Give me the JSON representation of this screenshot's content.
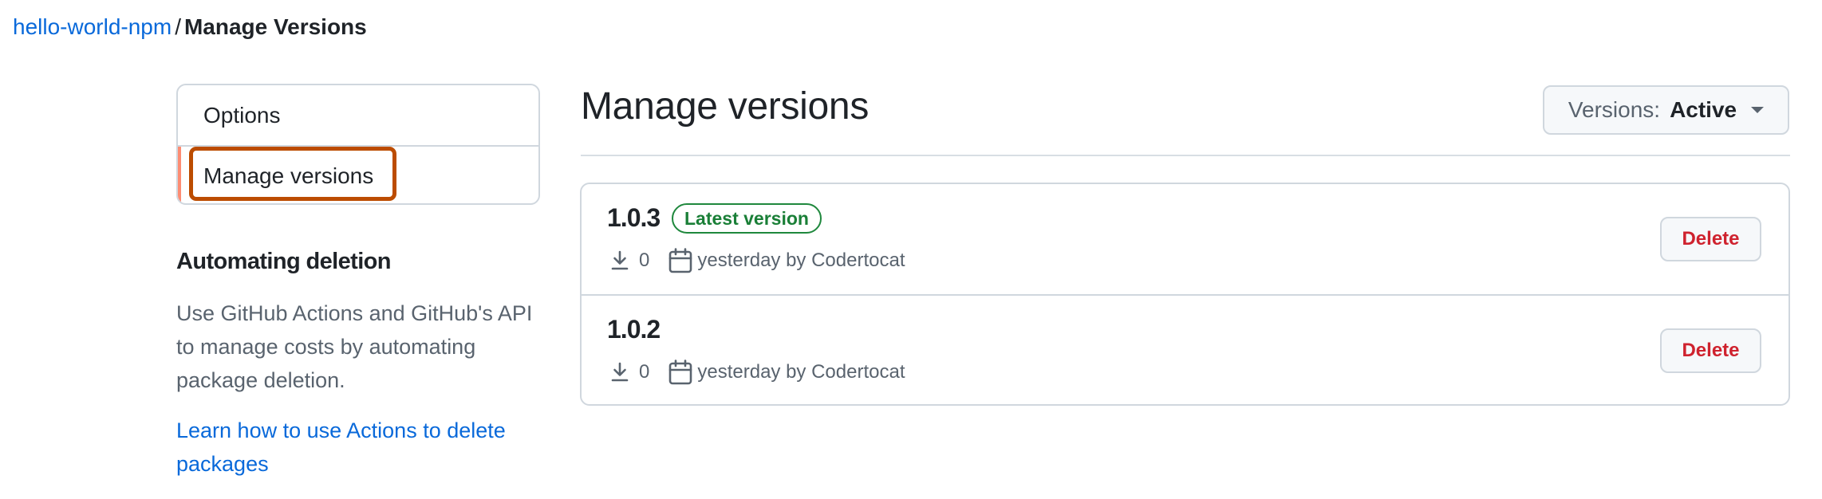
{
  "breadcrumb": {
    "package_link": "hello-world-npm",
    "separator": "/",
    "current": "Manage Versions"
  },
  "sidebar": {
    "items": [
      {
        "label": "Options",
        "selected": false
      },
      {
        "label": "Manage versions",
        "selected": true
      }
    ],
    "automating": {
      "heading": "Automating deletion",
      "description": "Use GitHub Actions and GitHub's API to manage costs by automating package deletion.",
      "link": "Learn how to use Actions to delete packages"
    }
  },
  "main": {
    "title": "Manage versions",
    "filter": {
      "label": "Versions:",
      "value": "Active"
    },
    "versions": [
      {
        "name": "1.0.3",
        "badge": "Latest version",
        "downloads": "0",
        "published": "yesterday by Codertocat",
        "delete_label": "Delete"
      },
      {
        "name": "1.0.2",
        "badge": null,
        "downloads": "0",
        "published": "yesterday by Codertocat",
        "delete_label": "Delete"
      }
    ]
  },
  "colors": {
    "link": "#0969da",
    "highlight": "#bc4c00",
    "selected_indicator": "#fd8c73",
    "badge_green": "#1a7f37",
    "danger": "#cf222e"
  }
}
